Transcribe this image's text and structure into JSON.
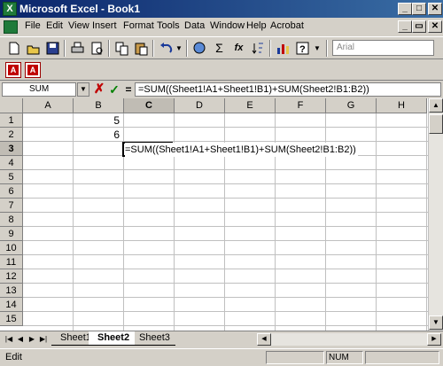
{
  "window": {
    "title": "Microsoft Excel - Book1",
    "app_icon": "X",
    "controls": [
      "_",
      "□",
      "✕"
    ],
    "doc_controls": [
      "_",
      "▭",
      "✕"
    ]
  },
  "menu": {
    "items": [
      "File",
      "Edit",
      "View",
      "Insert",
      "Format",
      "Tools",
      "Data",
      "Window",
      "Help",
      "Acrobat"
    ]
  },
  "toolbar": {
    "font_name": "Arial",
    "sum_label": "Σ",
    "fx_label": "fx"
  },
  "formula_bar": {
    "name_box": "SUM",
    "cancel": "✗",
    "enter": "✓",
    "equals": "=",
    "formula": "=SUM((Sheet1!A1+Sheet1!B1)+SUM(Sheet2!B1:B2))"
  },
  "grid": {
    "columns": [
      "A",
      "B",
      "C",
      "D",
      "E",
      "F",
      "G",
      "H"
    ],
    "rows": [
      "1",
      "2",
      "3",
      "4",
      "5",
      "6",
      "7",
      "8",
      "9",
      "10",
      "11",
      "12",
      "13",
      "14",
      "15"
    ],
    "active_column": "C",
    "active_row": "3",
    "cells": {
      "B1": "5",
      "B2": "6",
      "C3": "=SUM((Sheet1!A1+Sheet1!B1)+SUM(Sheet2!B1:B2))"
    }
  },
  "sheets": {
    "tabs": [
      "Sheet1",
      "Sheet2",
      "Sheet3"
    ],
    "active": "Sheet2"
  },
  "status": {
    "mode": "Edit",
    "num": "NUM"
  },
  "colors": {
    "title_start": "#0a246a",
    "title_end": "#3a6ea5",
    "chrome": "#d4d0c8",
    "cancel": "#c00000",
    "enter": "#008000"
  }
}
